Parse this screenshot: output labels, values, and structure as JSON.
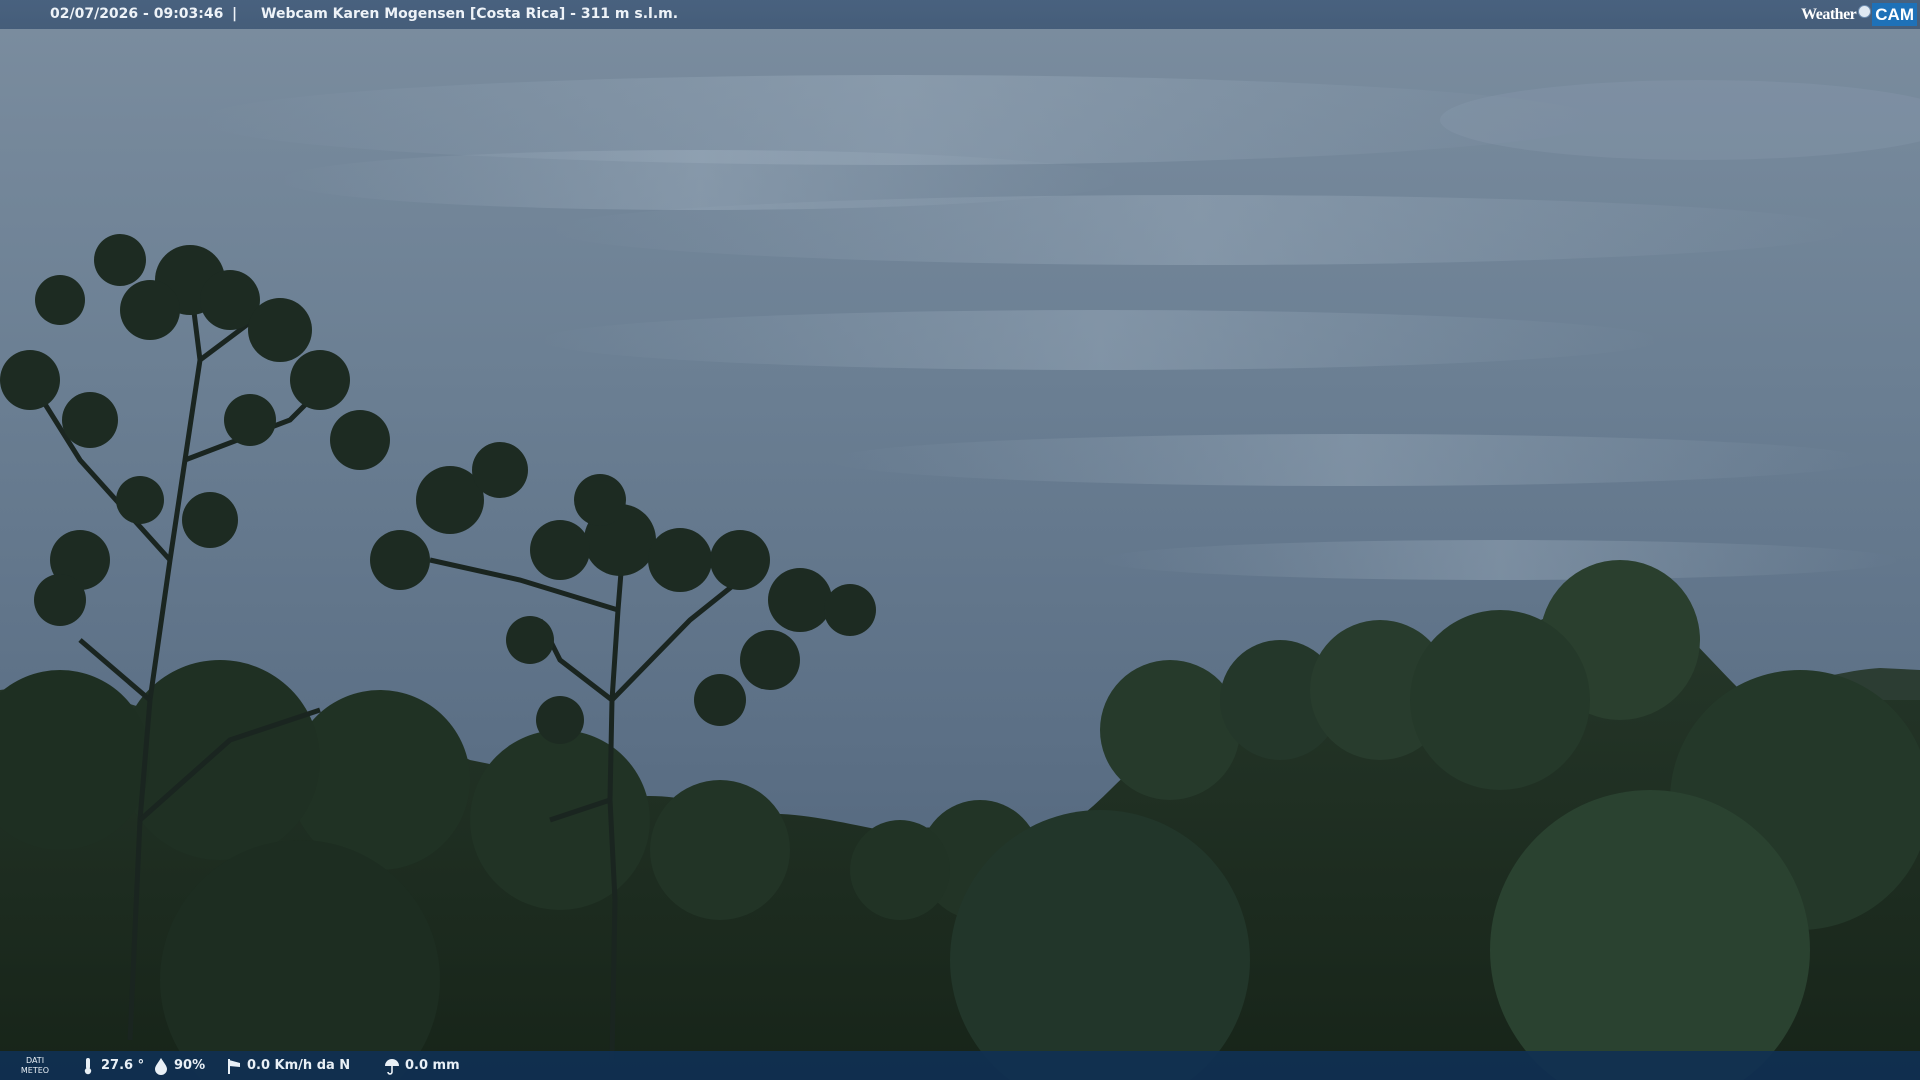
{
  "header": {
    "timestamp": "02/07/2026 - 09:03:46",
    "separator": "|",
    "title": "Webcam Karen Mogensen [Costa Rica]  - 311 m s.l.m."
  },
  "brand": {
    "word": "Weather",
    "cam": "CAM"
  },
  "weather": {
    "label_line1": "DATI",
    "label_line2": "METEO",
    "temperature": "27.6 °",
    "humidity": "90%",
    "wind": "0.0 Km/h da N",
    "rain": "0.0 mm"
  },
  "icons": [
    "thermometer-icon",
    "humidity-drop-icon",
    "wind-sock-icon",
    "rain-umbrella-icon"
  ],
  "colors": {
    "bar_top": "#46607d",
    "bar_bottom": "#103052",
    "brand_accent": "#1e71b8"
  }
}
